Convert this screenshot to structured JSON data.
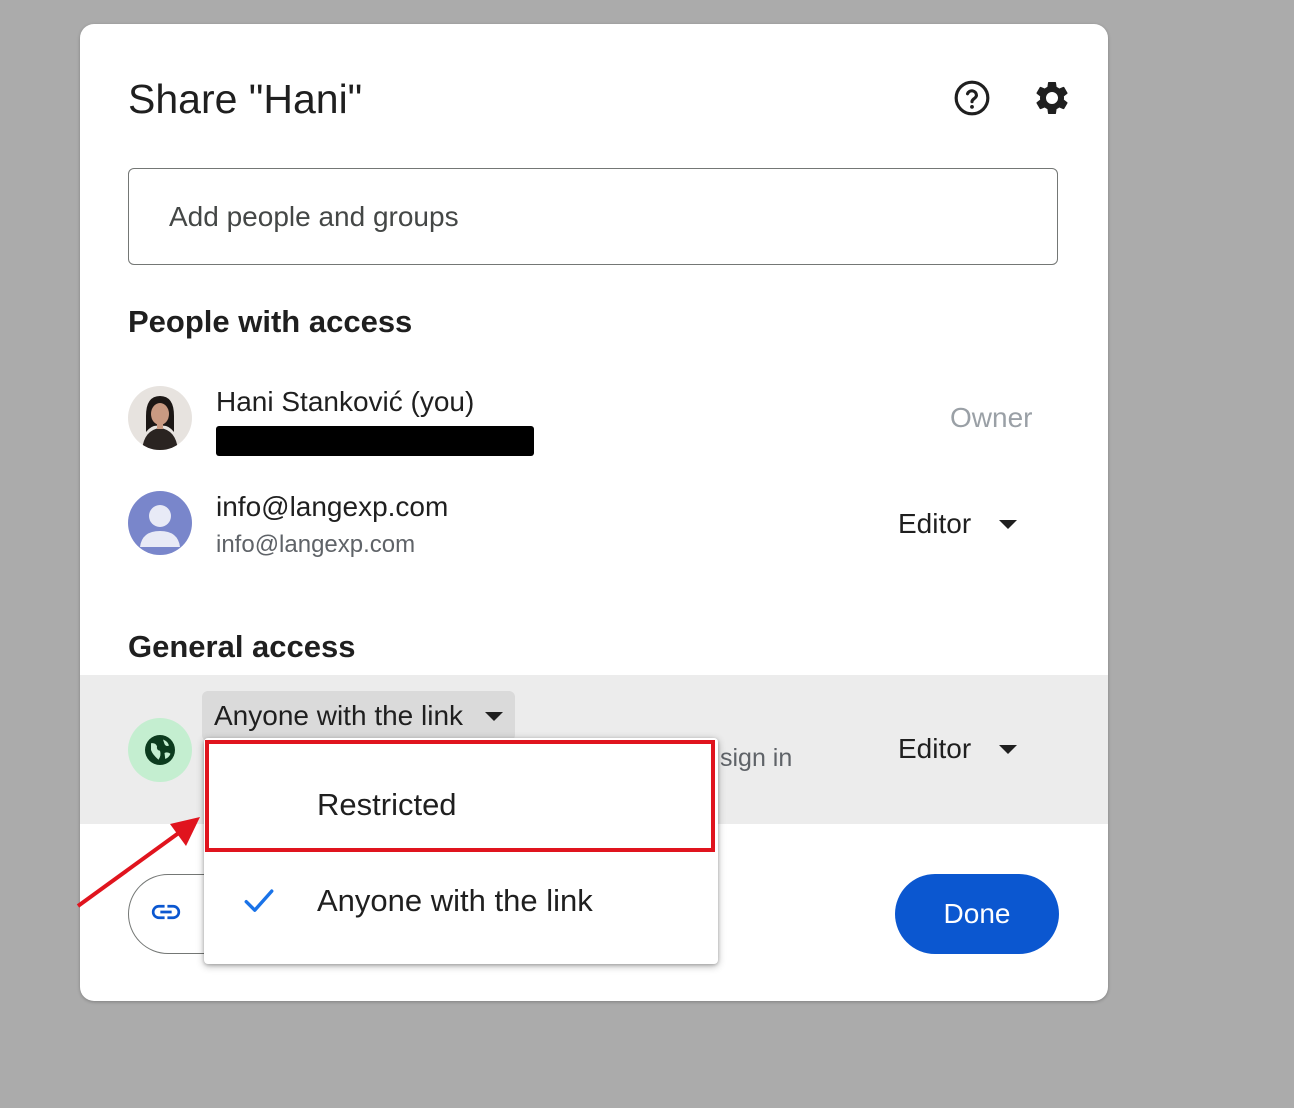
{
  "dialog": {
    "title": "Share \"Hani\"",
    "help_icon": "help-circle-icon",
    "settings_icon": "gear-icon"
  },
  "add_people": {
    "placeholder": "Add people and groups",
    "value": ""
  },
  "people_section": {
    "title": "People with access"
  },
  "people": [
    {
      "name": "Hani Stanković (you)",
      "role": "Owner",
      "avatar": "photo-avatar"
    },
    {
      "name": "info@langexp.com",
      "email": "info@langexp.com",
      "role": "Editor",
      "avatar": "person-avatar-icon"
    }
  ],
  "general_access": {
    "title": "General access",
    "selected": "Anyone with the link",
    "subtitle_visible": "sign in",
    "role": "Editor",
    "icon": "globe-icon"
  },
  "dropdown_menu": {
    "items": [
      {
        "label": "Restricted",
        "selected": false
      },
      {
        "label": "Anyone with the link",
        "selected": true
      }
    ]
  },
  "footer": {
    "copy_link_icon": "link-icon",
    "done_label": "Done"
  },
  "colors": {
    "primary": "#0b57d0",
    "highlight_box": "#e0141e",
    "globe_bg": "#c4eed0",
    "check": "#1a73e8"
  }
}
